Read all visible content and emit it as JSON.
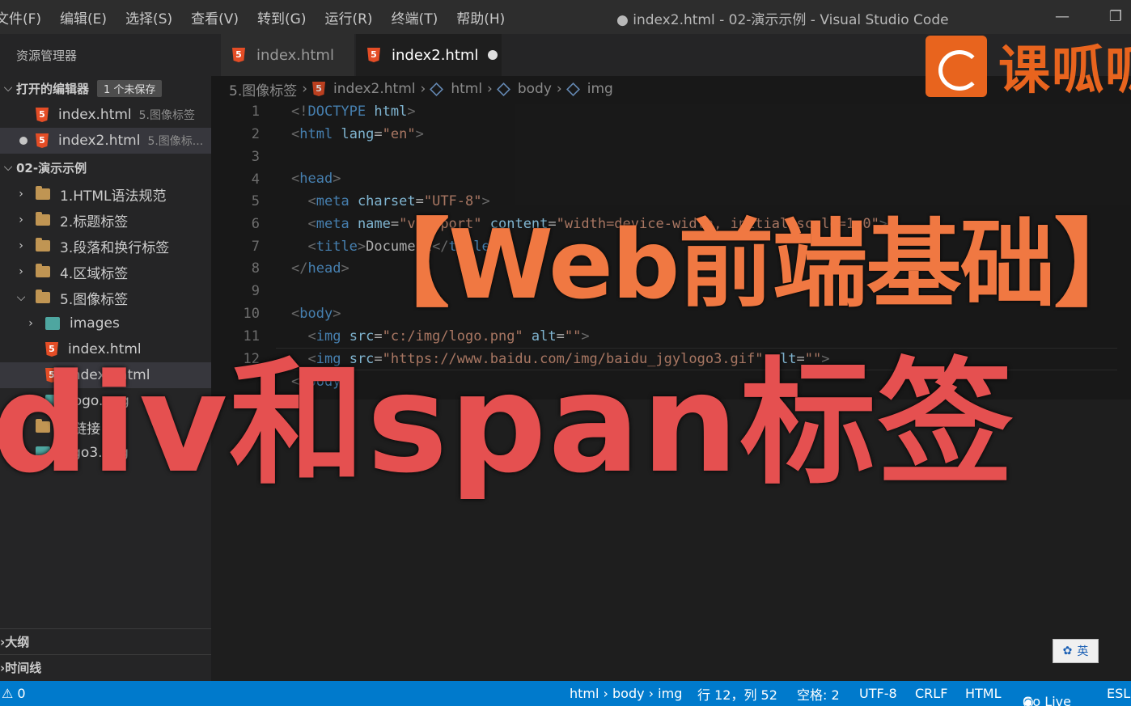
{
  "menu": [
    "文件(F)",
    "编辑(E)",
    "选择(S)",
    "查看(V)",
    "转到(G)",
    "运行(R)",
    "终端(T)",
    "帮助(H)"
  ],
  "window_title": "● index2.html - 02-演示示例 - Visual Studio Code",
  "sidebar": {
    "title": "资源管理器",
    "open_editors": {
      "label": "打开的编辑器",
      "badge": "1 个未保存"
    },
    "open_files": [
      {
        "name": "index.html",
        "desc": "5.图像标签"
      },
      {
        "name": "index2.html",
        "desc": "5.图像标..."
      }
    ],
    "workspace": "02-演示示例",
    "folders": [
      "1.HTML语法规范",
      "2.标题标签",
      "3.段落和换行标签",
      "4.区域标签",
      "5.图像标签"
    ],
    "sub_items": [
      "images",
      "index.html",
      "index2.html",
      "logo.png",
      "6.链接",
      "logo3.png"
    ],
    "outline": "大纲",
    "timeline": "时间线"
  },
  "tabs": [
    {
      "label": "index.html"
    },
    {
      "label": "index2.html"
    }
  ],
  "breadcrumb": [
    "5.图像标签",
    "index2.html",
    "html",
    "body",
    "img"
  ],
  "line_numbers": [
    "1",
    "2",
    "3",
    "4",
    "5",
    "6",
    "7",
    "8",
    "9",
    "10",
    "11",
    "12",
    "13"
  ],
  "overlay": {
    "title": "【Web前端基础】",
    "subtitle": "div和span标签",
    "brand": "课呱呱"
  },
  "ime": "英",
  "status": {
    "problems": "⚠ 0",
    "path": "html › body › img",
    "position": "行 12，列 52",
    "spaces": "空格: 2",
    "encoding": "UTF-8",
    "eol": "CRLF",
    "language": "HTML",
    "golive": "Go Live",
    "eslint": "ESLint"
  }
}
